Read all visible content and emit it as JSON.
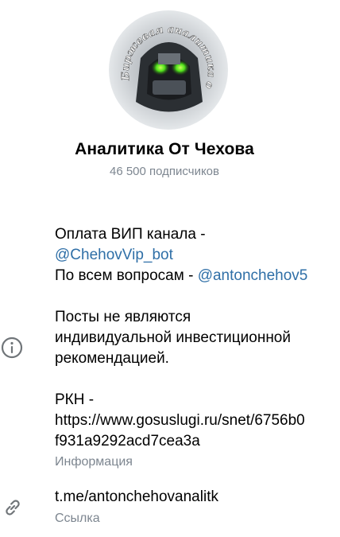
{
  "channel": {
    "title": "Аналитика От Чехова",
    "subscribers": "46 500 подписчиков",
    "avatar_text": "Биржевая аналитика от чехова"
  },
  "about": {
    "payment_text": "Оплата ВИП канала -",
    "payment_link": "@ChehovVip_bot",
    "questions_text": "По всем вопросам - ",
    "questions_link": "@antonchehov5",
    "disclaimer_line1": "Посты не являются",
    "disclaimer_line2": "индивидуальной инвестиционной",
    "disclaimer_line3": "рекомендацией.",
    "rkn_line1": "РКН -",
    "rkn_line2": "https://www.gosuslugi.ru/snet/6756b0",
    "rkn_line3": "f931a9292acd7cea3a",
    "label": "Информация"
  },
  "link": {
    "url": "t.me/antonchehovanalitk",
    "label": "Ссылка"
  },
  "icons": {
    "info": "info-icon",
    "link": "link-icon"
  },
  "colors": {
    "link": "#2f6fa7",
    "secondary": "#7d8690",
    "icon": "#707579"
  }
}
